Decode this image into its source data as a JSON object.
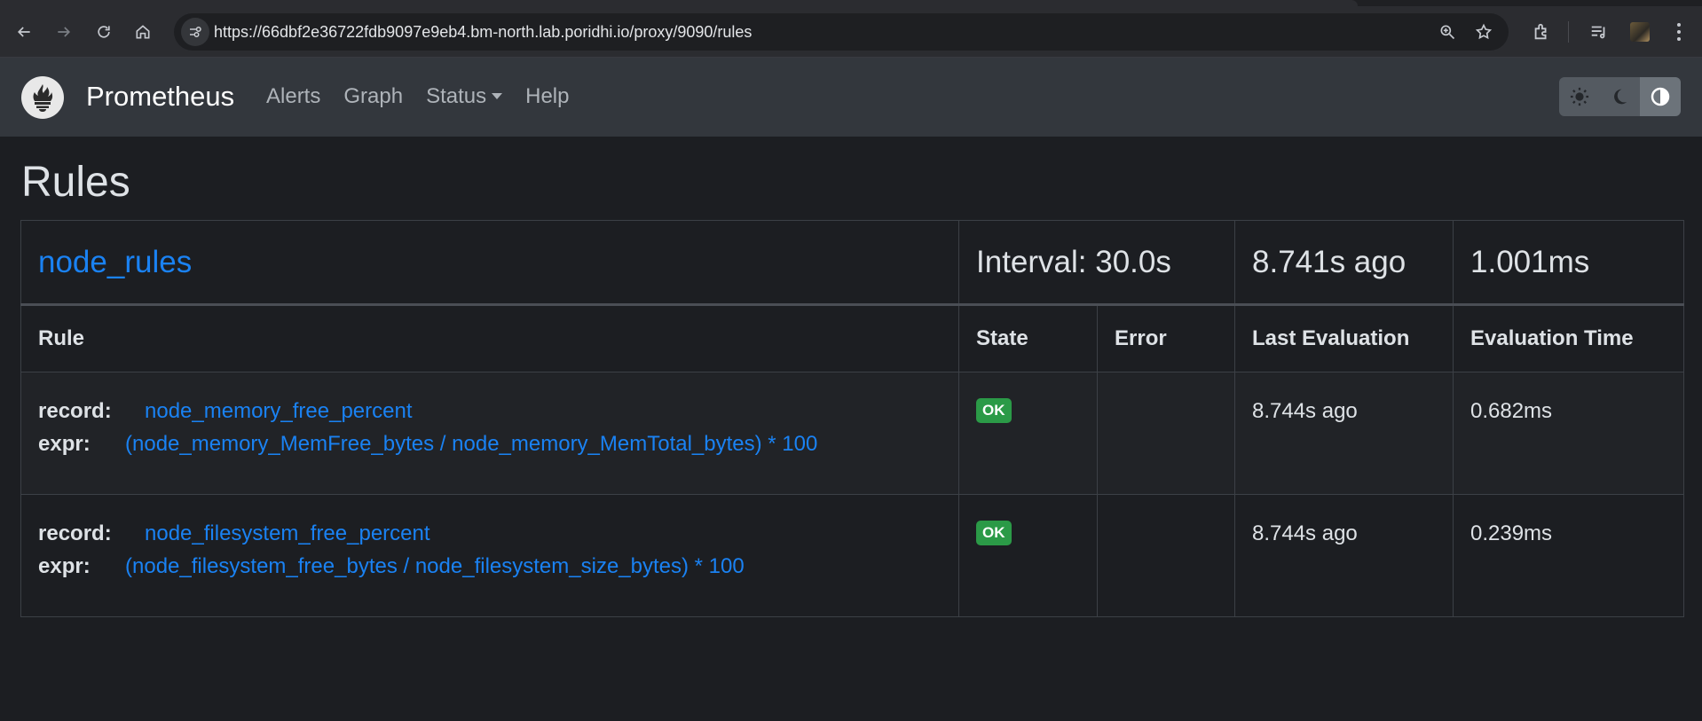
{
  "browser": {
    "url": "https://66dbf2e36722fdb9097e9eb4.bm-north.lab.poridhi.io/proxy/9090/rules",
    "icons": [
      "back-icon",
      "forward-icon",
      "reload-icon",
      "home-icon",
      "site-info-icon",
      "zoom-icon",
      "bookmark-star-icon",
      "extensions-icon",
      "media-icon",
      "profile-avatar",
      "menu-dots-icon"
    ]
  },
  "navbar": {
    "brand": "Prometheus",
    "links": [
      "Alerts",
      "Graph",
      "Status",
      "Help"
    ],
    "theme_buttons": [
      "light-theme",
      "dark-theme",
      "auto-theme"
    ]
  },
  "page": {
    "title": "Rules",
    "group": {
      "name": "node_rules",
      "interval": "Interval: 30.0s",
      "last_eval": "8.741s ago",
      "eval_time": "1.001ms"
    },
    "columns": [
      "Rule",
      "State",
      "Error",
      "Last Evaluation",
      "Evaluation Time"
    ],
    "rules": [
      {
        "record_key": "record:",
        "record": "node_memory_free_percent",
        "expr_key": "expr:",
        "expr": "(node_memory_MemFree_bytes / node_memory_MemTotal_bytes) * 100",
        "state": "OK",
        "error": "",
        "last_eval": "8.744s ago",
        "eval_time": "0.682ms"
      },
      {
        "record_key": "record:",
        "record": "node_filesystem_free_percent",
        "expr_key": "expr:",
        "expr": "(node_filesystem_free_bytes / node_filesystem_size_bytes) * 100",
        "state": "OK",
        "error": "",
        "last_eval": "8.744s ago",
        "eval_time": "0.239ms"
      }
    ]
  },
  "colors": {
    "link": "#1a82f3",
    "ok_badge": "#2b9a47",
    "background": "#1c1e22",
    "navbar": "#33373d"
  }
}
